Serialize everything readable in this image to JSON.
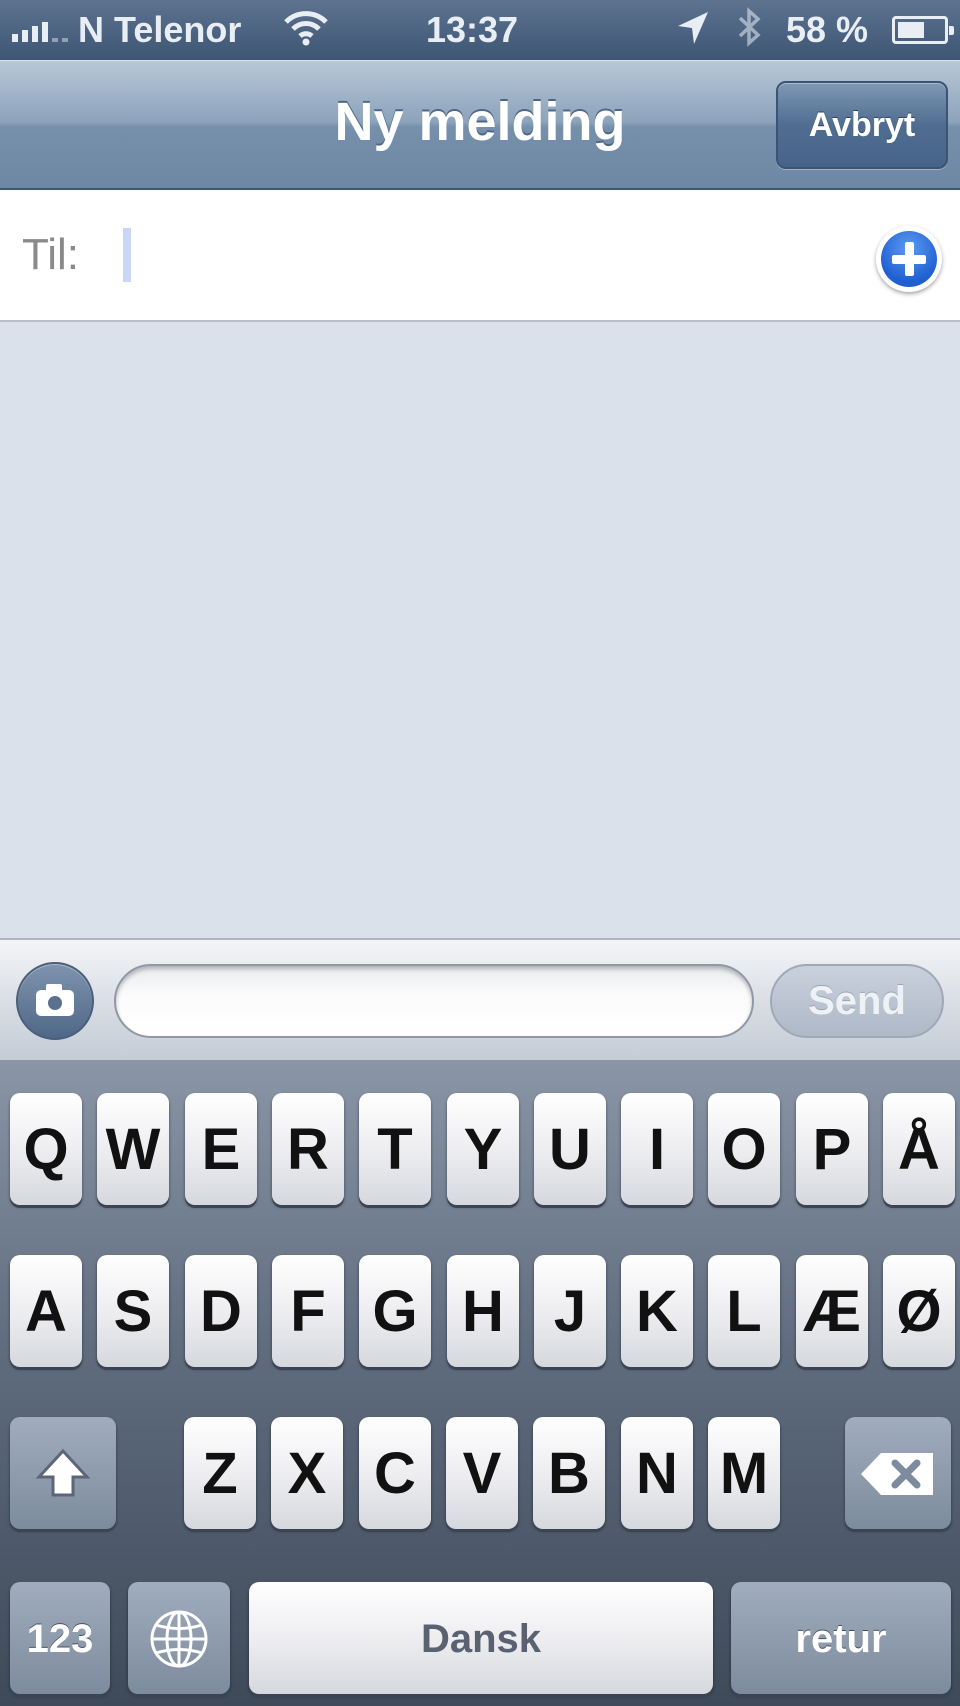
{
  "status_bar": {
    "carrier": "N Telenor",
    "time": "13:37",
    "battery_percent_text": "58 %",
    "battery_level": 0.58,
    "icons": [
      "signal-icon",
      "wifi-icon",
      "location-icon",
      "bluetooth-icon",
      "battery-icon"
    ]
  },
  "nav": {
    "title": "Ny melding",
    "cancel_label": "Avbryt"
  },
  "to_field": {
    "label": "Til:",
    "value": "",
    "add_icon": "plus-icon"
  },
  "compose": {
    "message_value": "",
    "send_label": "Send",
    "camera_icon": "camera-icon"
  },
  "keyboard": {
    "row1": [
      "Q",
      "W",
      "E",
      "R",
      "T",
      "Y",
      "U",
      "I",
      "O",
      "P",
      "Å"
    ],
    "row2": [
      "A",
      "S",
      "D",
      "F",
      "G",
      "H",
      "J",
      "K",
      "L",
      "Æ",
      "Ø"
    ],
    "row3": [
      "Z",
      "X",
      "C",
      "V",
      "B",
      "N",
      "M"
    ],
    "numbers_label": "123",
    "space_label": "Dansk",
    "return_label": "retur",
    "shift_icon": "shift-icon",
    "backspace_icon": "backspace-icon",
    "globe_icon": "globe-icon"
  },
  "colors": {
    "nav_bar": "#7690ac",
    "background": "#dae1eb",
    "add_button": "#1f5fd0"
  }
}
